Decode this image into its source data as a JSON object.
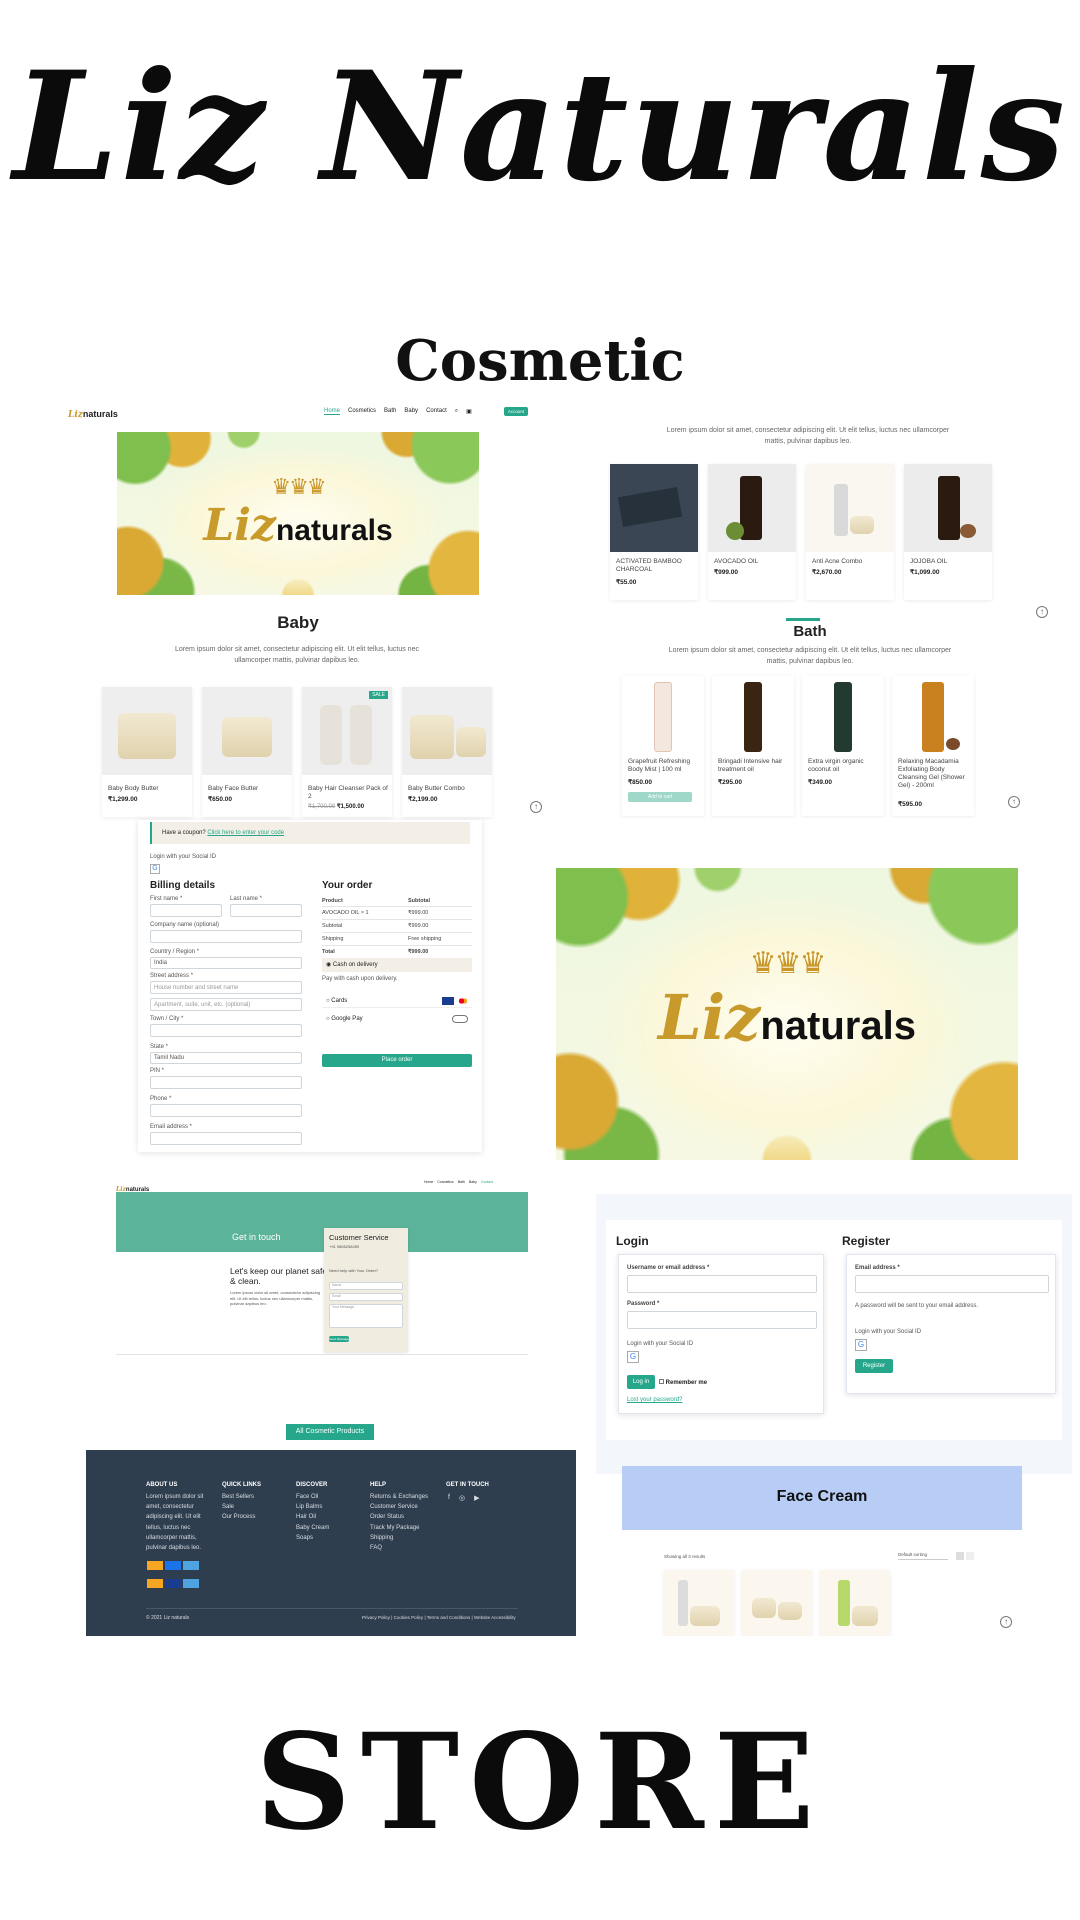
{
  "header": {
    "title": "Liz Naturals",
    "subtitle": "Cosmetic",
    "footer_word": "STORE"
  },
  "colors": {
    "accent": "#26a68a",
    "footer_bg": "#2f3e4f",
    "gold": "#c79a2b",
    "face_cream_bg": "#b7cdf6"
  },
  "home": {
    "logo": {
      "script": "Liz",
      "text": "naturals"
    },
    "nav": [
      "Home",
      "Cosmetics",
      "Bath",
      "Baby",
      "Contact"
    ],
    "account_btn": "Account",
    "banner_logo": {
      "script": "Liz",
      "text": "naturals"
    }
  },
  "cosmetics": {
    "lorem": "Lorem ipsum dolor sit amet, consectetur adipiscing elit. Ut elit tellus, luctus nec ullamcorper mattis, pulvinar dapibus leo.",
    "products": [
      {
        "name": "ACTIVATED BAMBOO CHARCOAL",
        "price": "₹55.00"
      },
      {
        "name": "AVOCADO OIL",
        "price": "₹999.00"
      },
      {
        "name": "Anti Acne Combo",
        "price": "₹2,670.00"
      },
      {
        "name": "JOJOBA OIL",
        "price": "₹1,099.00"
      }
    ]
  },
  "baby": {
    "heading": "Baby",
    "lorem": "Lorem ipsum dolor sit amet, consectetur adipiscing elit. Ut elit tellus, luctus nec ullamcorper mattis, pulvinar dapibus leo.",
    "sale_badge": "SALE",
    "products": [
      {
        "name": "Baby Body Butter",
        "price": "₹1,299.00"
      },
      {
        "name": "Baby Face Butter",
        "price": "₹650.00"
      },
      {
        "name": "Baby Hair Cleanser Pack of 2",
        "old_price": "₹1,700.00",
        "price": "₹1,500.00"
      },
      {
        "name": "Baby Butter Combo",
        "price": "₹2,199.00"
      }
    ]
  },
  "bath": {
    "heading": "Bath",
    "lorem": "Lorem ipsum dolor sit amet, consectetur adipiscing elit. Ut elit tellus, luctus nec ullamcorper mattis, pulvinar dapibus leo.",
    "add_to_cart": "Add to cart",
    "products": [
      {
        "name": "Grapefruit Refreshing Body Mist | 100 ml",
        "price": "₹850.00"
      },
      {
        "name": "Bringadi Intensive hair treatment oil",
        "price": "₹295.00"
      },
      {
        "name": "Extra virgin organic coconut oil",
        "price": "₹349.00"
      },
      {
        "name": "Relaxing Macadamia Exfoliating Body Cleansing Gel (Shower Gel) - 200ml",
        "price": "₹595.00"
      }
    ]
  },
  "checkout": {
    "coupon_text": "Have a coupon?",
    "coupon_link": "Click here to enter your code",
    "social_login": "Login with your Social ID",
    "billing_heading": "Billing details",
    "first_name": "First name *",
    "last_name": "Last name *",
    "company": "Company name (optional)",
    "country_label": "Country / Region *",
    "country_value": "India",
    "street_label": "Street address *",
    "street_placeholder": "House number and street name",
    "apt_placeholder": "Apartment, suite, unit, etc. (optional)",
    "city_label": "Town / City *",
    "state_label": "State *",
    "state_value": "Tamil Nadu",
    "pin_label": "PIN *",
    "phone_label": "Phone *",
    "email_label": "Email address *",
    "order_heading": "Your order",
    "order_cols": [
      "Product",
      "Subtotal"
    ],
    "order_rows": [
      {
        "label": "AVOCADO OIL × 1",
        "value": "₹999.00"
      },
      {
        "label": "Subtotal",
        "value": "₹999.00"
      },
      {
        "label": "Shipping",
        "value": "Free shipping"
      },
      {
        "label": "Total",
        "value": "₹999.00"
      }
    ],
    "cod": "Cash on delivery",
    "cod_note": "Pay with cash upon delivery.",
    "cards": "Cards",
    "gpay": "Google Pay",
    "place_order": "Place order"
  },
  "banner2": {
    "script": "Liz",
    "text": "naturals"
  },
  "contact": {
    "get_in_touch": "Get in touch",
    "tagline": "Let's keep our planet safe & clean.",
    "body": "Lorem ipsum dolor sit amet, consectetur adipiscing elit. Ut elit tellus, luctus nec ullamcorper mattis, pulvinar dapibus leo.",
    "cs_heading": "Customer Service",
    "cs_phone": "+91 9865258459",
    "need_help": "Need help with Your Order?",
    "fields": [
      "Name",
      "Email",
      "Your Message"
    ],
    "send_btn": "Send Message"
  },
  "account": {
    "login_heading": "Login",
    "register_heading": "Register",
    "username_label": "Username or email address *",
    "password_label": "Password *",
    "social_login": "Login with your Social ID",
    "login_btn": "Log in",
    "remember": "Remember me",
    "lost_password": "Lost your password?",
    "email_label": "Email address *",
    "register_note": "A password will be sent to your email address.",
    "register_social": "Login with your Social ID",
    "register_btn": "Register"
  },
  "footer": {
    "cta": "All Cosmetic Products",
    "about_h": "ABOUT US",
    "about_text": "Lorem ipsum dolor sit amet, consectetur adipiscing elit. Ut elit tellus, luctus nec ullamcorper mattis, pulvinar dapibus leo.",
    "quick_h": "QUICK LINKS",
    "quick_links": [
      "Best Sellers",
      "Sale",
      "Our Process"
    ],
    "discover_h": "DISCOVER",
    "discover_links": [
      "Face Oil",
      "Lip Balms",
      "Hair Oil",
      "Baby Cream",
      "Soaps"
    ],
    "help_h": "HELP",
    "help_links": [
      "Returns & Exchanges",
      "Customer Service",
      "Order Status",
      "Track My Package",
      "Shipping",
      "FAQ"
    ],
    "touch_h": "GET IN TOUCH",
    "copyright": "© 2021 Liz naturals",
    "legal": "Privacy Policy | Cookies Policy | Terms and Conditions | Website Accessibility"
  },
  "face_cream": {
    "heading": "Face Cream",
    "showing": "Showing all 3 results",
    "sort": "Default sorting"
  }
}
